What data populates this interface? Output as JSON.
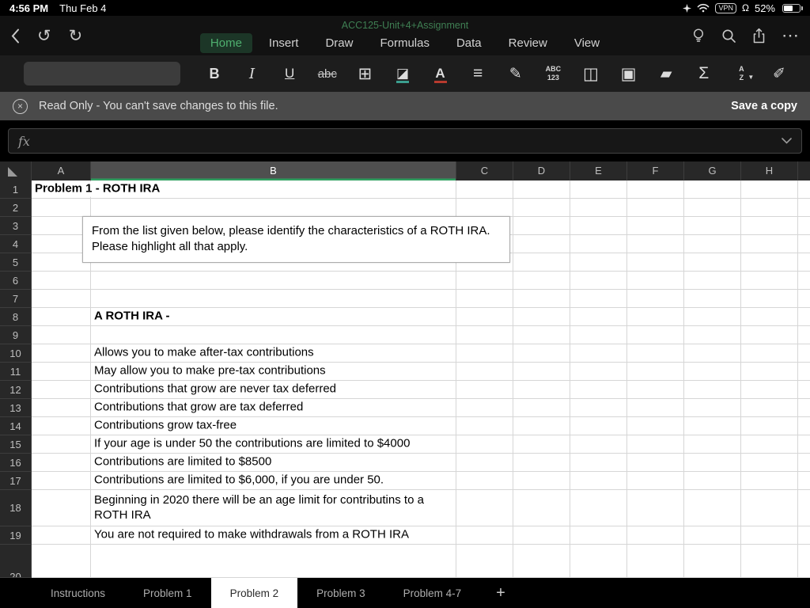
{
  "status_bar": {
    "time": "4:56 PM",
    "date": "Thu Feb 4",
    "battery_percent": "52%",
    "vpn_label": "VPN",
    "headset_glyph": "Ω"
  },
  "nav": {
    "title": "ACC125-Unit+4+Assignment",
    "tabs": [
      {
        "label": "Home",
        "active": true
      },
      {
        "label": "Insert",
        "active": false
      },
      {
        "label": "Draw",
        "active": false
      },
      {
        "label": "Formulas",
        "active": false
      },
      {
        "label": "Data",
        "active": false
      },
      {
        "label": "Review",
        "active": false
      },
      {
        "label": "View",
        "active": false
      }
    ],
    "undo_glyph": "↺",
    "redo_glyph": "↻",
    "more_glyph": "⋯"
  },
  "banner": {
    "message": "Read Only - You can't save changes to this file.",
    "action_label": "Save a copy"
  },
  "formula_bar": {
    "fx_label": "fx",
    "value": ""
  },
  "toolbar": {
    "icons": [
      {
        "name": "bold-icon",
        "glyph": "B",
        "deco": "g-bold"
      },
      {
        "name": "italic-icon",
        "glyph": "I",
        "deco": "g-italic"
      },
      {
        "name": "underline-icon",
        "glyph": "U",
        "deco": "g-underline"
      },
      {
        "name": "strikethrough-icon",
        "glyph": "abc",
        "deco": "g-strike"
      },
      {
        "name": "borders-icon",
        "glyph": "⊞",
        "deco": "g-big"
      },
      {
        "name": "fill-color-icon",
        "glyph": "◪",
        "deco": "g-fillbar"
      },
      {
        "name": "font-color-icon",
        "glyph": "A",
        "deco": "g-colorbar"
      },
      {
        "name": "align-icon",
        "glyph": "≡",
        "deco": "g-big"
      },
      {
        "name": "cell-styles-icon",
        "glyph": "✎"
      },
      {
        "name": "number-format-icon",
        "glyph": "ABC",
        "glyph2": "123"
      },
      {
        "name": "insert-cells-icon",
        "glyph": "◫",
        "deco": "g-big"
      },
      {
        "name": "merge-cells-icon",
        "glyph": "▣",
        "deco": "g-big"
      },
      {
        "name": "clear-icon",
        "glyph": "▰"
      },
      {
        "name": "autosum-icon",
        "glyph": "Σ",
        "deco": "g-big"
      },
      {
        "name": "sort-filter-icon",
        "glyph": "A",
        "glyph2": "Z",
        "funnel": true
      },
      {
        "name": "ink-icon",
        "glyph": "✐"
      }
    ]
  },
  "grid": {
    "selected_column": "B",
    "columns": [
      "A",
      "B",
      "C",
      "D",
      "E",
      "F",
      "G",
      "H"
    ],
    "rows": [
      {
        "n": 1,
        "cells": [
          {
            "col": "A",
            "text": "Problem 1 - ROTH IRA",
            "bold": true,
            "spill": true
          }
        ]
      },
      {
        "n": 2,
        "cells": []
      },
      {
        "n": 3,
        "cells": []
      },
      {
        "n": 4,
        "cells": []
      },
      {
        "n": 5,
        "cells": []
      },
      {
        "n": 6,
        "cells": []
      },
      {
        "n": 7,
        "cells": []
      },
      {
        "n": 8,
        "cells": [
          {
            "col": "B",
            "text": "A ROTH IRA -",
            "bold": true
          }
        ]
      },
      {
        "n": 9,
        "cells": []
      },
      {
        "n": 10,
        "cells": [
          {
            "col": "B",
            "text": "Allows you to make after-tax contributions"
          }
        ]
      },
      {
        "n": 11,
        "cells": [
          {
            "col": "B",
            "text": "May allow you to make pre-tax contributions"
          }
        ]
      },
      {
        "n": 12,
        "cells": [
          {
            "col": "B",
            "text": "Contributions that grow are never tax deferred"
          }
        ]
      },
      {
        "n": 13,
        "cells": [
          {
            "col": "B",
            "text": "Contributions that grow  are tax deferred"
          }
        ]
      },
      {
        "n": 14,
        "cells": [
          {
            "col": "B",
            "text": "Contributions grow tax-free"
          }
        ]
      },
      {
        "n": 15,
        "cells": [
          {
            "col": "B",
            "text": "If your age is under 50 the contributions are limited to $4000"
          }
        ]
      },
      {
        "n": 16,
        "cells": [
          {
            "col": "B",
            "text": "Contributions are limited to $8500"
          }
        ]
      },
      {
        "n": 17,
        "cells": [
          {
            "col": "B",
            "text": "Contributions are limited to $6,000, if you are under 50."
          }
        ]
      },
      {
        "n": 18,
        "cells": [
          {
            "col": "B",
            "text": "Beginning in 2020 there will be an age limit for contributins to a ROTH IRA",
            "wrap": true
          }
        ]
      },
      {
        "n": 19,
        "cells": [
          {
            "col": "B",
            "text": "You are not required to make withdrawals from a ROTH IRA"
          }
        ]
      },
      {
        "n": 20,
        "cells": []
      }
    ]
  },
  "textbox": {
    "line1": "From the list given below, please identify the characteristics of a ROTH IRA.",
    "line2": "Please highlight all that apply."
  },
  "sheet_bar": {
    "tabs": [
      {
        "label": "Instructions",
        "active": false
      },
      {
        "label": "Problem 1",
        "active": false
      },
      {
        "label": "Problem 2",
        "active": true
      },
      {
        "label": "Problem 3",
        "active": false
      },
      {
        "label": "Problem 4-7",
        "active": false
      }
    ],
    "add_label": "+"
  }
}
